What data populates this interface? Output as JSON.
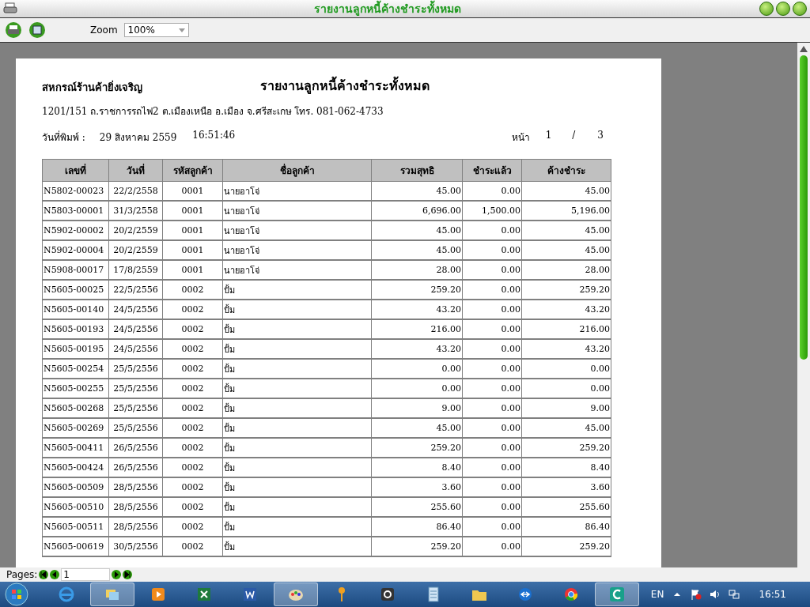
{
  "window": {
    "title": "รายงานลูกหนี้ค้างชำระทั้งหมด"
  },
  "toolbar": {
    "zoom_label": "Zoom",
    "zoom_value": "100%"
  },
  "report": {
    "company": "สหกรณ์ร้านค้ายิ่งเจริญ",
    "title": "รายงานลูกหนี้ค้างชำระทั้งหมด",
    "address": "1201/151 ถ.ราชการรถไฟ2 ต.เมืองเหนือ อ.เมือง จ.ศรีสะเกษ  โทร. 081-062-4733",
    "print_label": "วันที่พิมพ์ :",
    "print_date": "29 สิงหาคม 2559",
    "print_time": "16:51:46",
    "page_label": "หน้า",
    "page_current": "1",
    "page_sep": "/",
    "page_total": "3",
    "table": {
      "columns": [
        "เลขที่",
        "วันที่",
        "รหัสลูกค้า",
        "ชื่อลูกค้า",
        "รวมสุทธิ",
        "ชำระแล้ว",
        "ค้างชำระ"
      ],
      "rows": [
        [
          "N5802-00023",
          "22/2/2558",
          "0001",
          "นายอาโจ่",
          "45.00",
          "0.00",
          "45.00"
        ],
        [
          "N5803-00001",
          "31/3/2558",
          "0001",
          "นายอาโจ่",
          "6,696.00",
          "1,500.00",
          "5,196.00"
        ],
        [
          "N5902-00002",
          "20/2/2559",
          "0001",
          "นายอาโจ่",
          "45.00",
          "0.00",
          "45.00"
        ],
        [
          "N5902-00004",
          "20/2/2559",
          "0001",
          "นายอาโจ่",
          "45.00",
          "0.00",
          "45.00"
        ],
        [
          "N5908-00017",
          "17/8/2559",
          "0001",
          "นายอาโจ่",
          "28.00",
          "0.00",
          "28.00"
        ],
        [
          "N5605-00025",
          "22/5/2556",
          "0002",
          "ปั้ม",
          "259.20",
          "0.00",
          "259.20"
        ],
        [
          "N5605-00140",
          "24/5/2556",
          "0002",
          "ปั้ม",
          "43.20",
          "0.00",
          "43.20"
        ],
        [
          "N5605-00193",
          "24/5/2556",
          "0002",
          "ปั้ม",
          "216.00",
          "0.00",
          "216.00"
        ],
        [
          "N5605-00195",
          "24/5/2556",
          "0002",
          "ปั้ม",
          "43.20",
          "0.00",
          "43.20"
        ],
        [
          "N5605-00254",
          "25/5/2556",
          "0002",
          "ปั้ม",
          "0.00",
          "0.00",
          "0.00"
        ],
        [
          "N5605-00255",
          "25/5/2556",
          "0002",
          "ปั้ม",
          "0.00",
          "0.00",
          "0.00"
        ],
        [
          "N5605-00268",
          "25/5/2556",
          "0002",
          "ปั้ม",
          "9.00",
          "0.00",
          "9.00"
        ],
        [
          "N5605-00269",
          "25/5/2556",
          "0002",
          "ปั้ม",
          "45.00",
          "0.00",
          "45.00"
        ],
        [
          "N5605-00411",
          "26/5/2556",
          "0002",
          "ปั้ม",
          "259.20",
          "0.00",
          "259.20"
        ],
        [
          "N5605-00424",
          "26/5/2556",
          "0002",
          "ปั้ม",
          "8.40",
          "0.00",
          "8.40"
        ],
        [
          "N5605-00509",
          "28/5/2556",
          "0002",
          "ปั้ม",
          "3.60",
          "0.00",
          "3.60"
        ],
        [
          "N5605-00510",
          "28/5/2556",
          "0002",
          "ปั้ม",
          "255.60",
          "0.00",
          "255.60"
        ],
        [
          "N5605-00511",
          "28/5/2556",
          "0002",
          "ปั้ม",
          "86.40",
          "0.00",
          "86.40"
        ],
        [
          "N5605-00619",
          "30/5/2556",
          "0002",
          "ปั้ม",
          "259.20",
          "0.00",
          "259.20"
        ]
      ]
    }
  },
  "pager": {
    "label": "Pages:",
    "value": "1"
  },
  "taskbar": {
    "apps": [
      {
        "kind": "ie",
        "selected": false
      },
      {
        "kind": "explorer",
        "selected": true
      },
      {
        "kind": "media",
        "selected": false
      },
      {
        "kind": "excel",
        "selected": false
      },
      {
        "kind": "word",
        "selected": false
      },
      {
        "kind": "paint",
        "selected": true
      },
      {
        "kind": "key",
        "selected": false
      },
      {
        "kind": "camera",
        "selected": false
      },
      {
        "kind": "notepad",
        "selected": false
      },
      {
        "kind": "folder",
        "selected": false
      },
      {
        "kind": "teamviewer",
        "selected": false
      },
      {
        "kind": "chrome",
        "selected": false
      },
      {
        "kind": "app",
        "selected": true
      }
    ],
    "language": "EN",
    "time": "16:51"
  }
}
